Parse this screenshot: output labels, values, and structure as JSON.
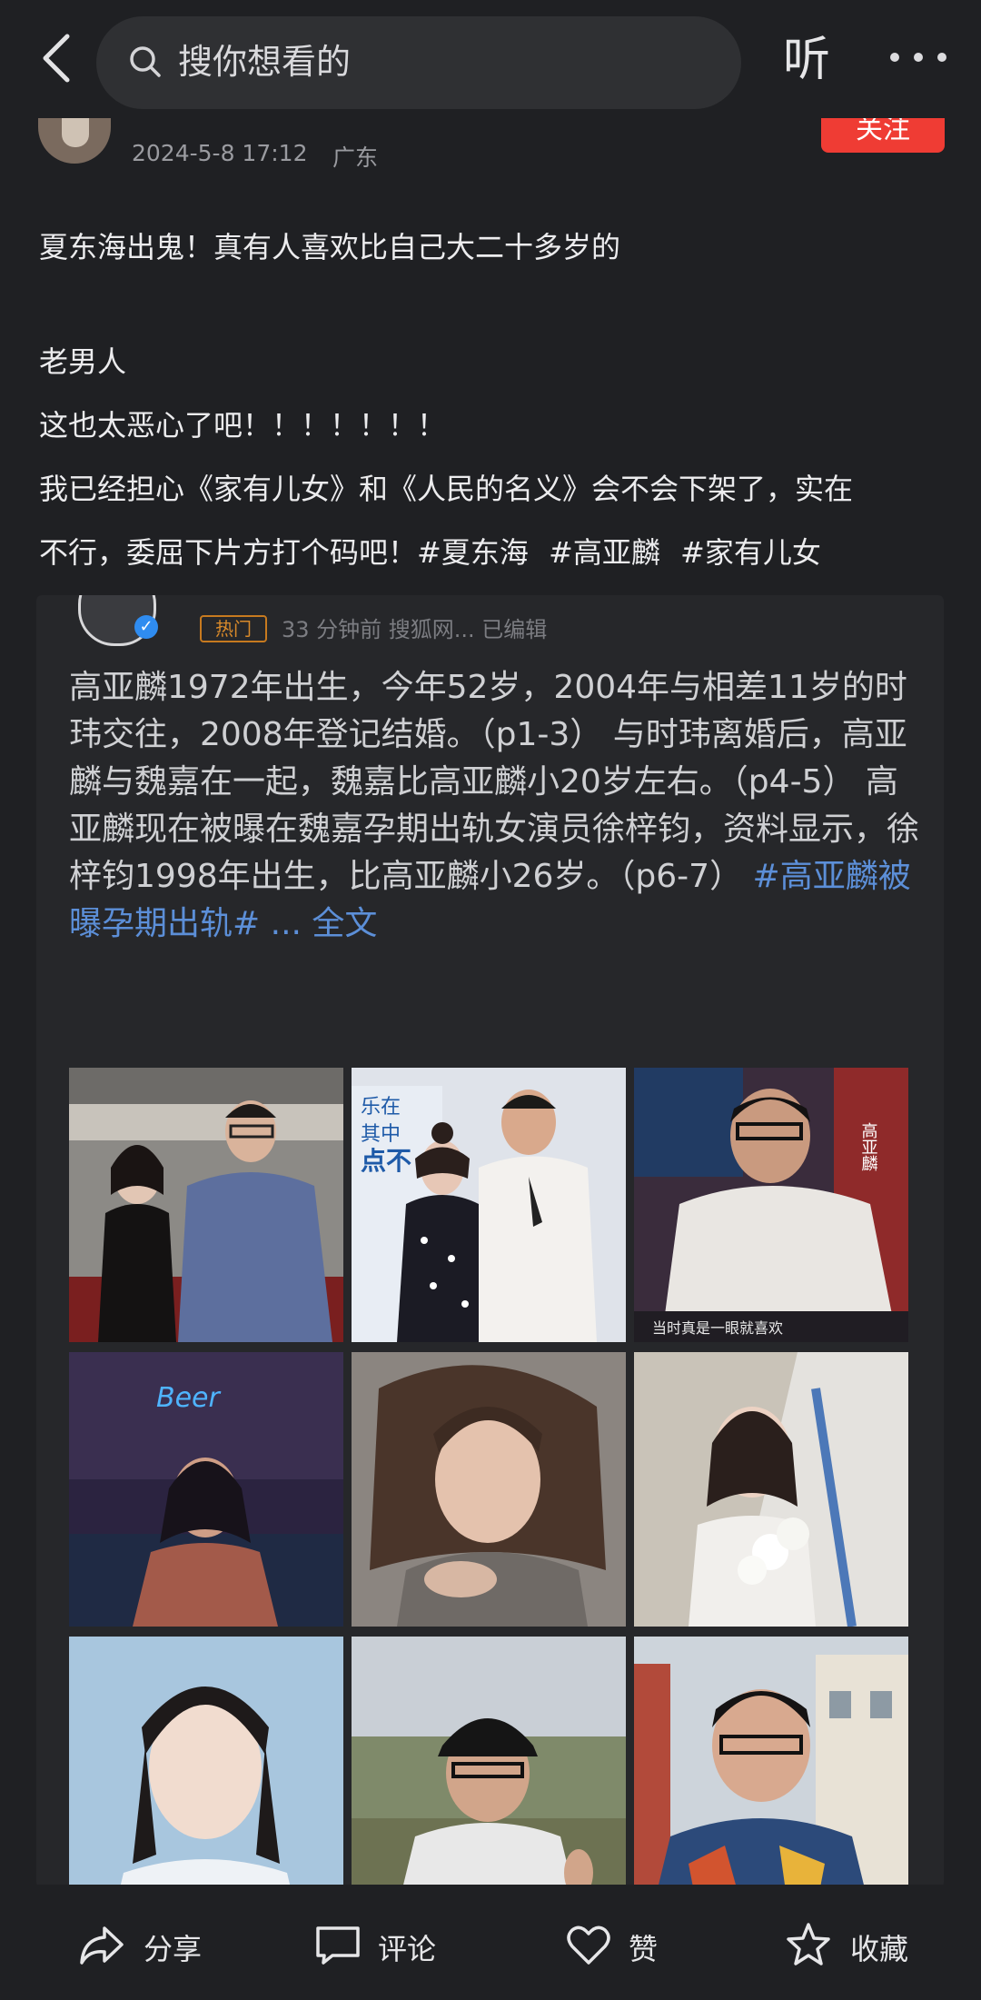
{
  "header": {
    "search_placeholder": "搜你想看的",
    "listen_label": "听"
  },
  "author": {
    "time": "2024-5-8 17:12",
    "location": "广东",
    "follow_label": "关注"
  },
  "post": {
    "line1": "夏东海出鬼！真有人喜欢比自己大二十多岁的",
    "line2": "老男人",
    "line3": "这也太恶心了吧！！！！！！！",
    "line4": "我已经担心《家有儿女》和《人民的名义》会不会下架了，实在",
    "line5_text": "不行，委屈下片方打个码吧！",
    "tags": [
      "#夏东海",
      "#高亚麟",
      "#家有儿女"
    ]
  },
  "repost": {
    "hot_badge": "热门",
    "meta": "33 分钟前 搜狐网... 已编辑",
    "text": "高亚麟1972年出生，今年52岁，2004年与相差11岁的时玮交往，2008年登记结婚。（p1-3） 与时玮离婚后，高亚麟与魏嘉在一起，魏嘉比高亚麟小20岁左右。（p4-5） 高亚麟现在被曝在魏嘉孕期出轨女演员徐梓钧，资料显示，徐梓钧1998年出生，比高亚麟小26岁。（p6-7）",
    "hashtag": "#高亚麟被曝孕期出轨#",
    "more": "... 全文",
    "photo_captions": {
      "p2_caption_1": "乐在",
      "p2_caption_2": "其中",
      "p2_caption_3": "点不",
      "p3_name": "高亚麟",
      "p3_sub": "当时真是一眼就喜欢",
      "p4_neon": "Beer"
    }
  },
  "actions": {
    "share": "分享",
    "comment": "评论",
    "like": "赞",
    "favorite": "收藏"
  },
  "colors": {
    "background": "#1f2023",
    "follow": "#ef3c34",
    "link": "#5c8fd8"
  }
}
